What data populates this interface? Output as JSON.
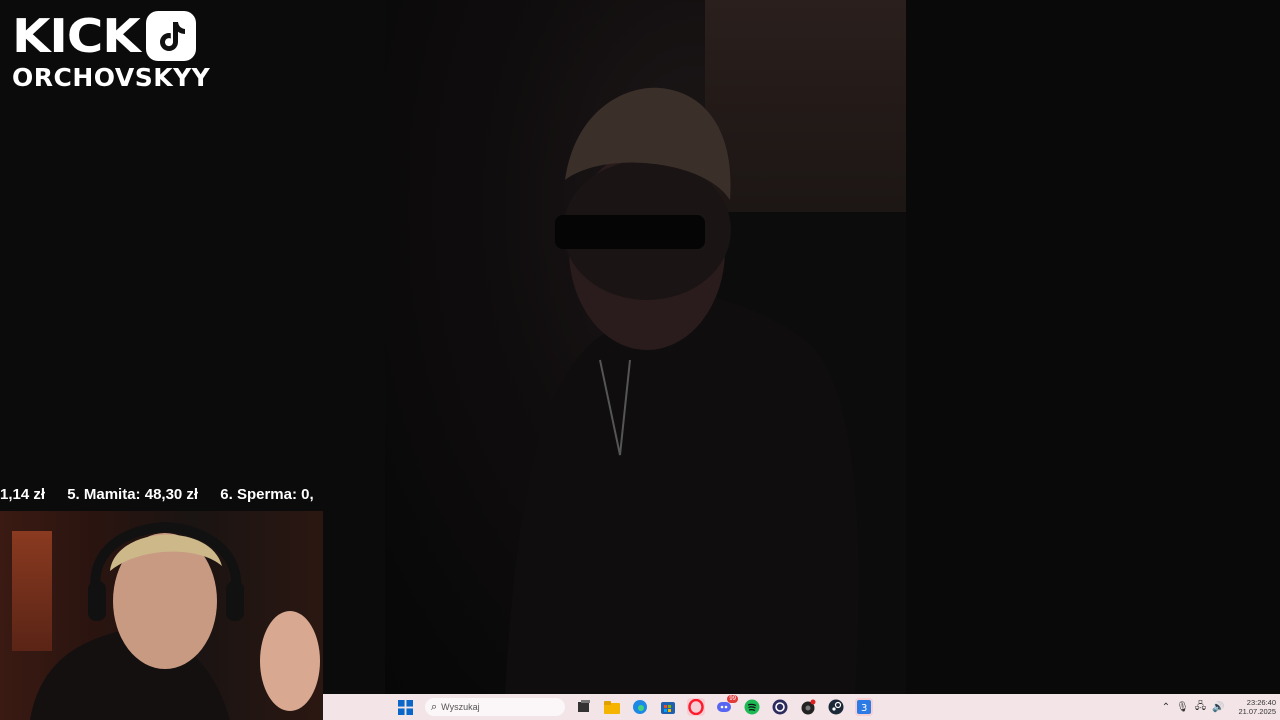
{
  "brand": {
    "logo_text": "KICK",
    "tiktok_icon": "tiktok-icon",
    "channel": "ORCHOVSKYY"
  },
  "ticker": {
    "items": [
      "1,14 zł",
      "5. Mamita: 48,30 zł",
      "6. Sperma: 0,"
    ]
  },
  "taskbar": {
    "search_placeholder": "Wyszukaj",
    "time": "23:26:40",
    "date": "21.07.2025",
    "discord_badge": "99"
  },
  "colors": {
    "taskbar_bg": "#f3e4e7",
    "spotify": "#1db954",
    "opera": "#ff1b2d",
    "edge": "#1e88e5"
  }
}
